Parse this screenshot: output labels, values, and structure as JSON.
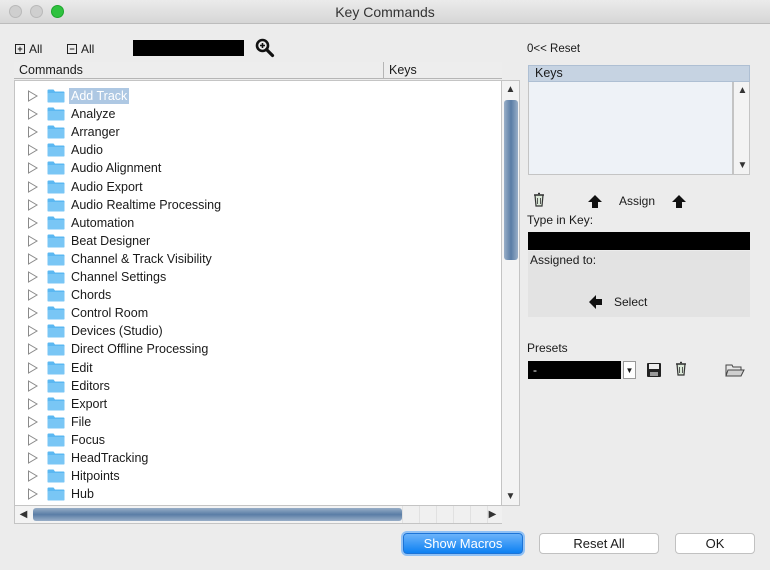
{
  "window": {
    "title": "Key Commands"
  },
  "toolbar": {
    "expand_all_label": "All",
    "collapse_all_label": "All",
    "search_value": ""
  },
  "columns": {
    "commands": "Commands",
    "keys": "Keys"
  },
  "commands": [
    {
      "label": "Add Track",
      "selected": true
    },
    {
      "label": "Analyze"
    },
    {
      "label": "Arranger"
    },
    {
      "label": "Audio"
    },
    {
      "label": "Audio Alignment"
    },
    {
      "label": "Audio Export"
    },
    {
      "label": "Audio Realtime Processing"
    },
    {
      "label": "Automation"
    },
    {
      "label": "Beat Designer"
    },
    {
      "label": "Channel & Track Visibility"
    },
    {
      "label": "Channel Settings"
    },
    {
      "label": "Chords"
    },
    {
      "label": "Control Room"
    },
    {
      "label": "Devices (Studio)"
    },
    {
      "label": "Direct Offline Processing"
    },
    {
      "label": "Edit"
    },
    {
      "label": "Editors"
    },
    {
      "label": "Export"
    },
    {
      "label": "File"
    },
    {
      "label": "Focus"
    },
    {
      "label": "HeadTracking"
    },
    {
      "label": "Hitpoints"
    },
    {
      "label": "Hub"
    }
  ],
  "right_panel": {
    "reset_label": "0<< Reset",
    "keys_header": "Keys",
    "assign_label": "Assign",
    "type_in_key_label": "Type in Key:",
    "type_in_key_value": "",
    "assigned_to_label": "Assigned to:",
    "select_label": "Select",
    "presets_label": "Presets",
    "preset_value": "-"
  },
  "footer": {
    "show_macros": "Show Macros",
    "reset_all": "Reset All",
    "ok": "OK"
  },
  "colors": {
    "folder": "#5bb8f2",
    "selection": "#aec8e3",
    "scroll_thumb": "#5a7da6",
    "primary_button": "#0d80f2"
  }
}
